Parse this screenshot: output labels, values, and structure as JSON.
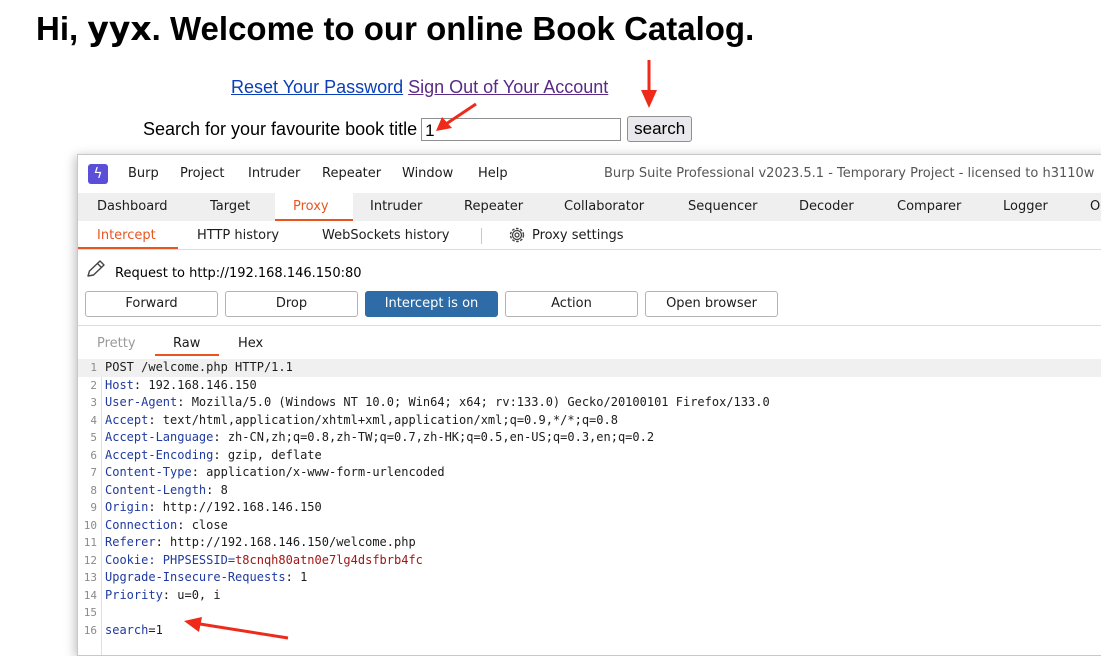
{
  "page": {
    "greeting_prefix": "Hi, ",
    "username": "yyx",
    "greeting_suffix": ". Welcome to our online Book Catalog.",
    "reset_link": "Reset Your Password",
    "signout_link": "Sign Out of Your Account",
    "search_label": "Search for your favourite book title",
    "search_value": "1",
    "search_button": "search"
  },
  "burp": {
    "menu": [
      "Burp",
      "Project",
      "Intruder",
      "Repeater",
      "Window",
      "Help"
    ],
    "window_title": "Burp Suite Professional v2023.5.1 - Temporary Project - licensed to h3110w",
    "top_tabs": [
      "Dashboard",
      "Target",
      "Proxy",
      "Intruder",
      "Repeater",
      "Collaborator",
      "Sequencer",
      "Decoder",
      "Comparer",
      "Logger",
      "O"
    ],
    "active_top_tab": "Proxy",
    "sub_tabs": [
      "Intercept",
      "HTTP history",
      "WebSockets history"
    ],
    "proxy_settings": "Proxy settings",
    "request_to": "Request to http://192.168.146.150:80",
    "buttons": [
      "Forward",
      "Drop",
      "Intercept is on",
      "Action",
      "Open browser"
    ],
    "view_tabs": [
      "Pretty",
      "Raw",
      "Hex"
    ],
    "request_lines": [
      {
        "n": "1",
        "name": "",
        "rest": "POST /welcome.php HTTP/1.1"
      },
      {
        "n": "2",
        "name": "Host",
        "rest": ": 192.168.146.150"
      },
      {
        "n": "3",
        "name": "User-Agent",
        "rest": ": Mozilla/5.0 (Windows NT 10.0; Win64; x64; rv:133.0) Gecko/20100101 Firefox/133.0"
      },
      {
        "n": "4",
        "name": "Accept",
        "rest": ": text/html,application/xhtml+xml,application/xml;q=0.9,*/*;q=0.8"
      },
      {
        "n": "5",
        "name": "Accept-Language",
        "rest": ": zh-CN,zh;q=0.8,zh-TW;q=0.7,zh-HK;q=0.5,en-US;q=0.3,en;q=0.2"
      },
      {
        "n": "6",
        "name": "Accept-Encoding",
        "rest": ": gzip, deflate"
      },
      {
        "n": "7",
        "name": "Content-Type",
        "rest": ": application/x-www-form-urlencoded"
      },
      {
        "n": "8",
        "name": "Content-Length",
        "rest": ": 8"
      },
      {
        "n": "9",
        "name": "Origin",
        "rest": ": http://192.168.146.150"
      },
      {
        "n": "10",
        "name": "Connection",
        "rest": ": close"
      },
      {
        "n": "11",
        "name": "Referer",
        "rest": ": http://192.168.146.150/welcome.php"
      },
      {
        "n": "12",
        "name": "Cookie",
        "rest": ": PHPSESSID=",
        "value": "t8cnqh80atn0e7lg4dsfbrb4fc"
      },
      {
        "n": "13",
        "name": "Upgrade-Insecure-Requests",
        "rest": ": 1"
      },
      {
        "n": "14",
        "name": "Priority",
        "rest": ": u=0, i"
      },
      {
        "n": "15",
        "name": "",
        "rest": ""
      },
      {
        "n": "16",
        "name": "search",
        "rest": "=1"
      }
    ]
  },
  "colors": {
    "accent": "#e8561f",
    "primary_button": "#2e6ca7",
    "arrow": "#ee2a1b"
  }
}
